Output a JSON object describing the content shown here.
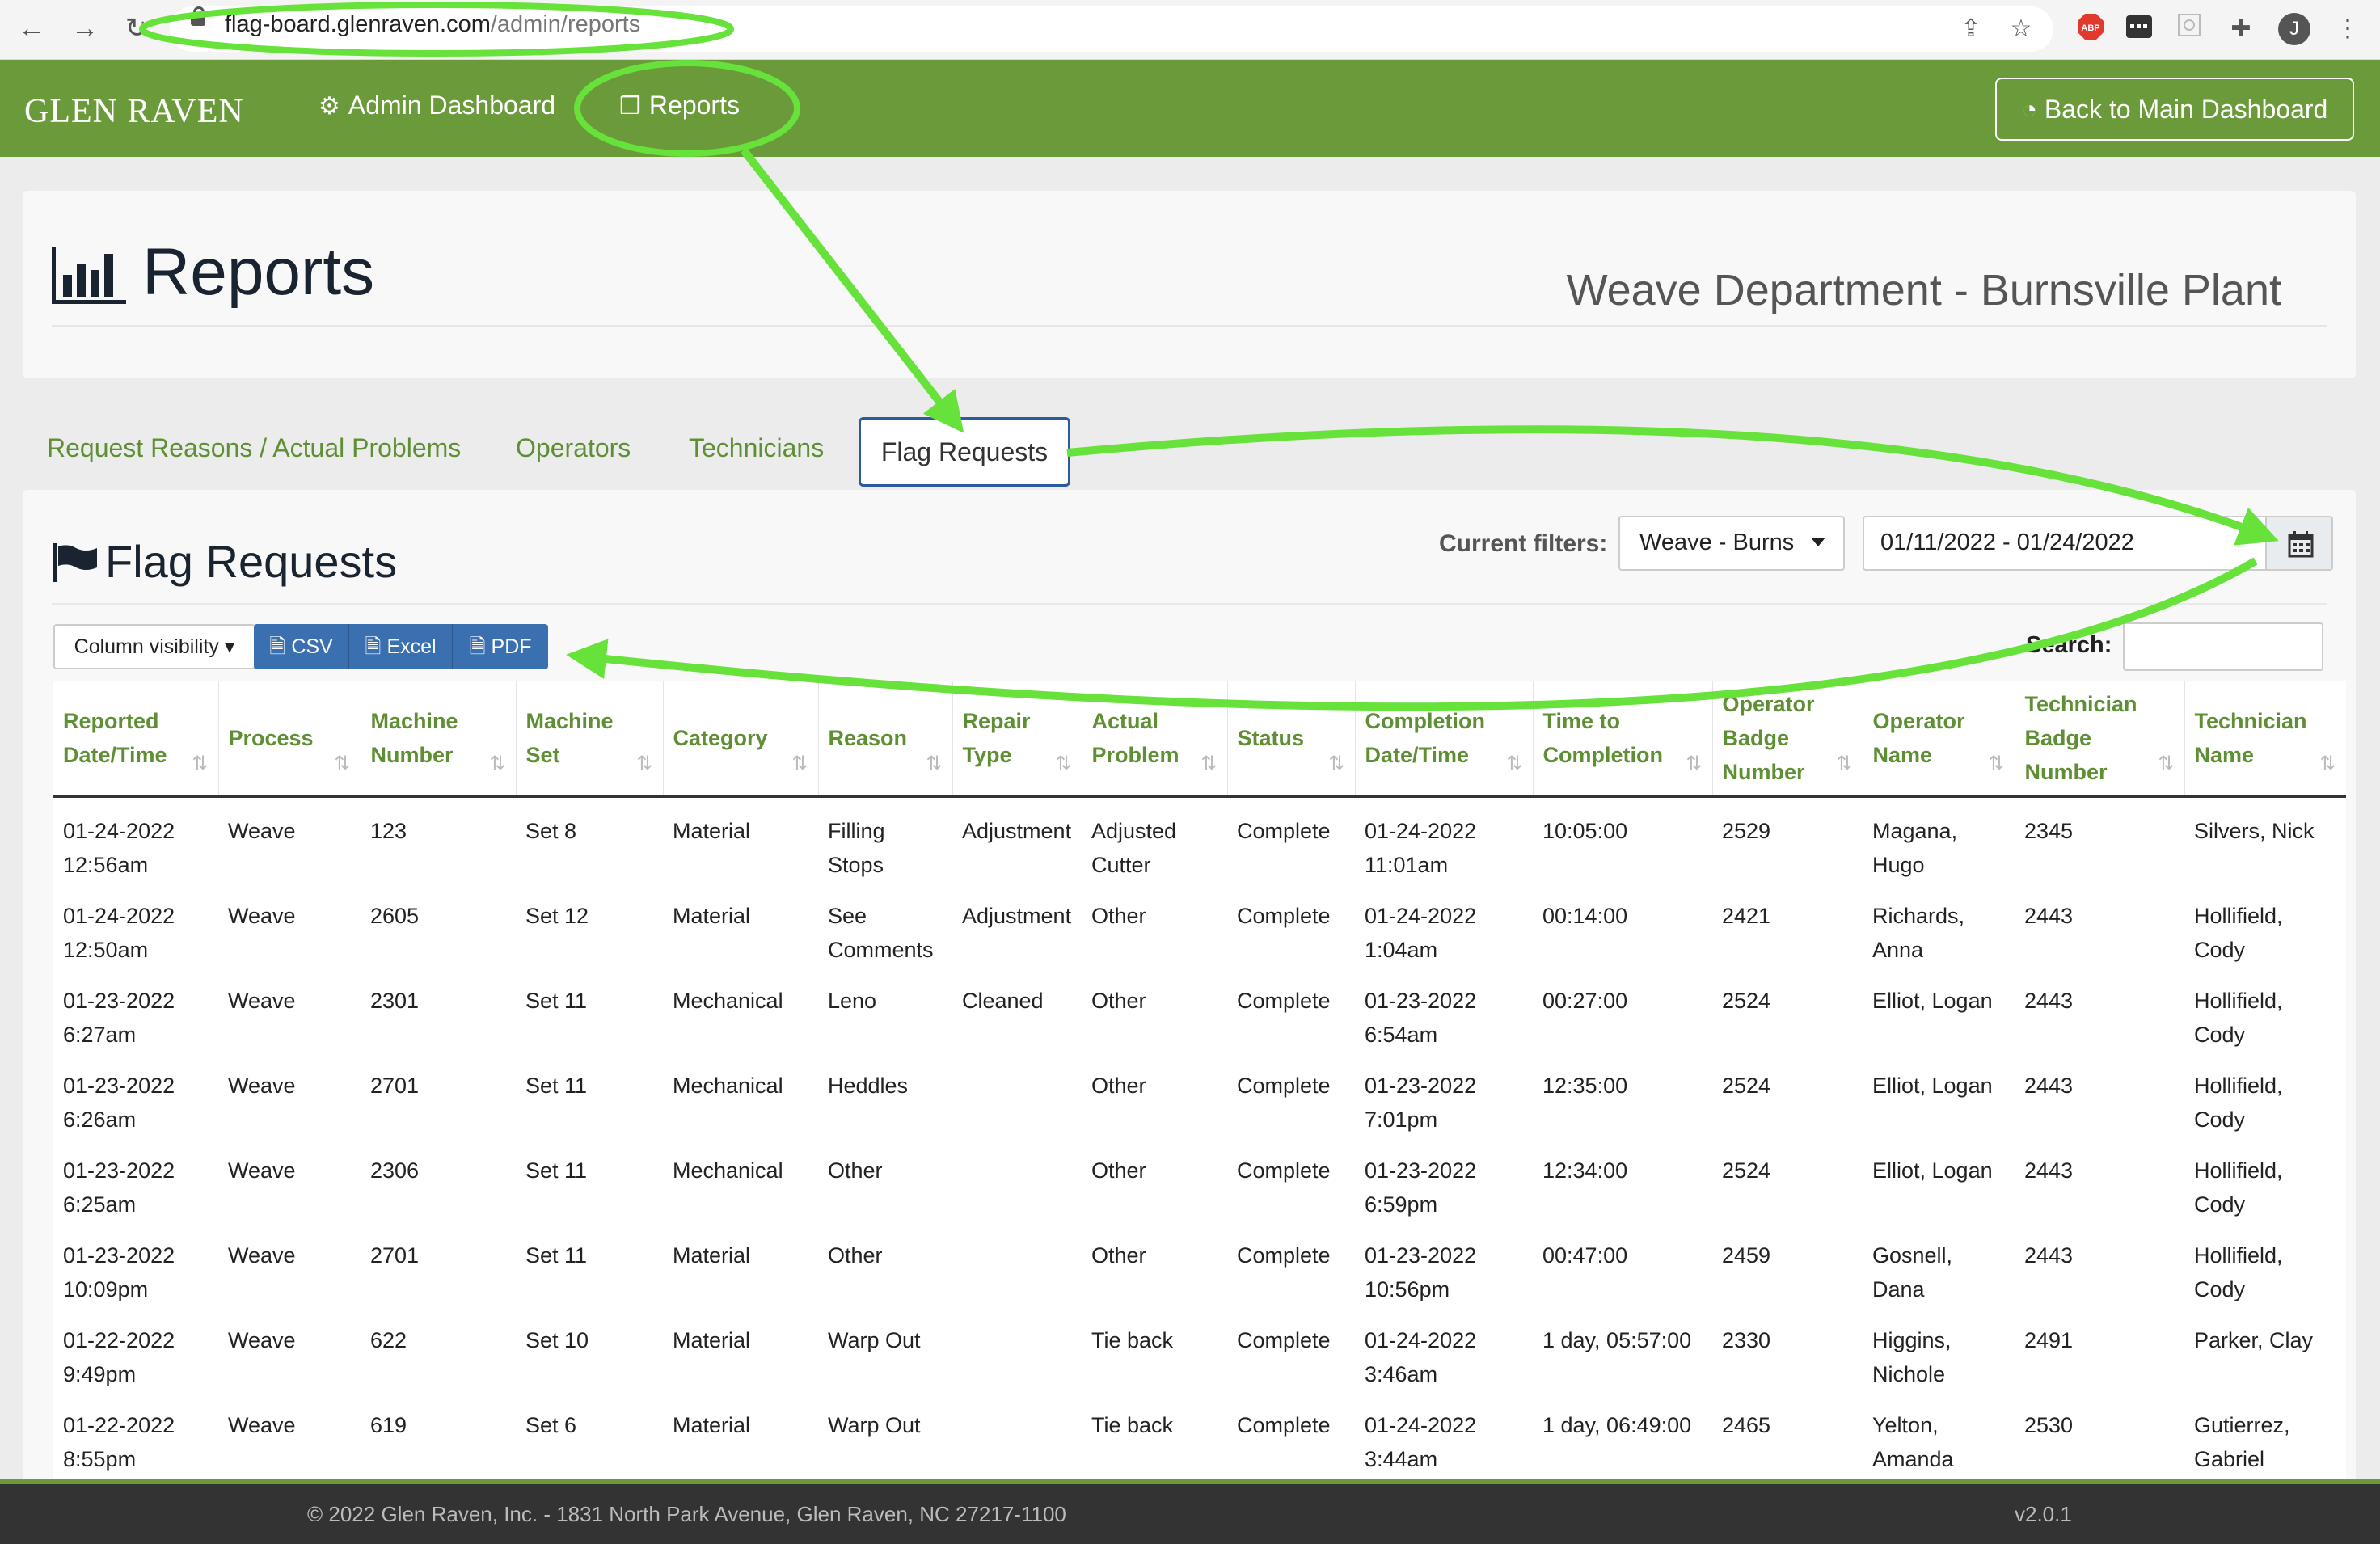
{
  "browser": {
    "url_domain": "flag-board.glenraven.com",
    "url_path": "/admin/reports",
    "avatar_letter": "J",
    "adblock_label": "ABP"
  },
  "nav": {
    "logo": "GLEN RAVEN",
    "admin_dashboard": "Admin Dashboard",
    "reports": "Reports",
    "back_button": "Back to Main Dashboard"
  },
  "header": {
    "title": "Reports",
    "department": "Weave Department - Burnsville Plant"
  },
  "tabs": [
    {
      "label": "Request Reasons / Actual Problems"
    },
    {
      "label": "Operators"
    },
    {
      "label": "Technicians"
    },
    {
      "label": "Flag Requests",
      "active": true
    }
  ],
  "section": {
    "title": "Flag Requests",
    "filters_label": "Current filters:",
    "dept_select_value": "Weave - Burns",
    "date_range": "01/11/2022 - 01/24/2022",
    "column_visibility": "Column visibility",
    "export_buttons": [
      "CSV",
      "Excel",
      "PDF"
    ],
    "search_label": "Search:"
  },
  "table": {
    "headers": [
      "Reported Date/Time",
      "Process",
      "Machine Number",
      "Machine Set",
      "Category",
      "Reason",
      "Repair Type",
      "Actual Problem",
      "Status",
      "Completion Date/Time",
      "Time to Completion",
      "Operator Badge Number",
      "Operator Name",
      "Technician Badge Number",
      "Technician Name"
    ],
    "rows": [
      [
        "01-24-2022 12:56am",
        "Weave",
        "123",
        "Set 8",
        "Material",
        "Filling Stops",
        "Adjustment",
        "Adjusted Cutter",
        "Complete",
        "01-24-2022 11:01am",
        "10:05:00",
        "2529",
        "Magana, Hugo",
        "2345",
        "Silvers, Nick"
      ],
      [
        "01-24-2022 12:50am",
        "Weave",
        "2605",
        "Set 12",
        "Material",
        "See Comments",
        "Adjustment",
        "Other",
        "Complete",
        "01-24-2022 1:04am",
        "00:14:00",
        "2421",
        "Richards, Anna",
        "2443",
        "Hollifield, Cody"
      ],
      [
        "01-23-2022 6:27am",
        "Weave",
        "2301",
        "Set 11",
        "Mechanical",
        "Leno",
        "Cleaned",
        "Other",
        "Complete",
        "01-23-2022 6:54am",
        "00:27:00",
        "2524",
        "Elliot, Logan",
        "2443",
        "Hollifield, Cody"
      ],
      [
        "01-23-2022 6:26am",
        "Weave",
        "2701",
        "Set 11",
        "Mechanical",
        "Heddles",
        "",
        "Other",
        "Complete",
        "01-23-2022 7:01pm",
        "12:35:00",
        "2524",
        "Elliot, Logan",
        "2443",
        "Hollifield, Cody"
      ],
      [
        "01-23-2022 6:25am",
        "Weave",
        "2306",
        "Set 11",
        "Mechanical",
        "Other",
        "",
        "Other",
        "Complete",
        "01-23-2022 6:59pm",
        "12:34:00",
        "2524",
        "Elliot, Logan",
        "2443",
        "Hollifield, Cody"
      ],
      [
        "01-23-2022 10:09pm",
        "Weave",
        "2701",
        "Set 11",
        "Material",
        "Other",
        "",
        "Other",
        "Complete",
        "01-23-2022 10:56pm",
        "00:47:00",
        "2459",
        "Gosnell, Dana",
        "2443",
        "Hollifield, Cody"
      ],
      [
        "01-22-2022 9:49pm",
        "Weave",
        "622",
        "Set 10",
        "Material",
        "Warp Out",
        "",
        "Tie back",
        "Complete",
        "01-24-2022 3:46am",
        "1 day, 05:57:00",
        "2330",
        "Higgins, Nichole",
        "2491",
        "Parker, Clay"
      ],
      [
        "01-22-2022 8:55pm",
        "Weave",
        "619",
        "Set 6",
        "Material",
        "Warp Out",
        "",
        "Tie back",
        "Complete",
        "01-24-2022 3:44am",
        "1 day, 06:49:00",
        "2465",
        "Yelton, Amanda",
        "2530",
        "Gutierrez, Gabriel"
      ]
    ]
  },
  "footer": {
    "copyright": "© 2022 Glen Raven, Inc. - 1831 North Park Avenue, Glen Raven, NC 27217-1100",
    "version": "v2.0.1"
  },
  "colors": {
    "brand_green": "#6b9a3a",
    "link_green": "#5f8f34",
    "annotation_green": "#66e23a",
    "button_blue": "#3a6fb0",
    "footer_dark": "#333333"
  }
}
